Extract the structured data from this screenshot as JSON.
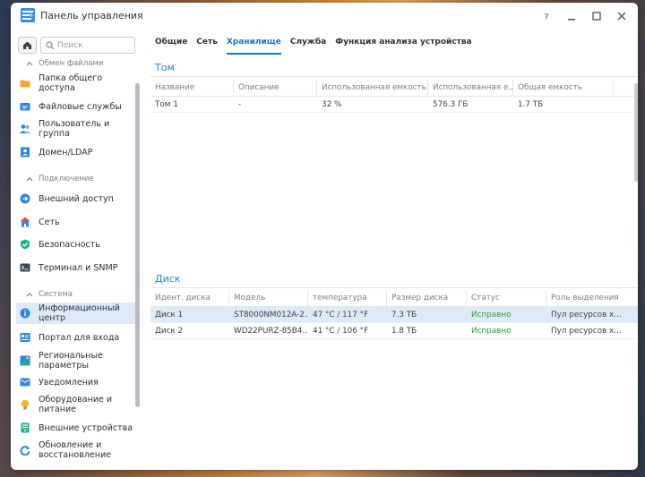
{
  "window": {
    "title": "Панель управления"
  },
  "sidebar": {
    "search_placeholder": "Поиск",
    "sections": [
      {
        "label": "Обмен файлами",
        "items": [
          {
            "label": "Папка общего доступа",
            "icon": "folder-icon"
          },
          {
            "label": "Файловые службы",
            "icon": "file-services-icon"
          },
          {
            "label": "Пользователь и группа",
            "icon": "users-icon"
          },
          {
            "label": "Домен/LDAP",
            "icon": "domain-icon"
          }
        ]
      },
      {
        "label": "Подключение",
        "items": [
          {
            "label": "Внешний доступ",
            "icon": "external-access-icon"
          },
          {
            "label": "Сеть",
            "icon": "network-icon"
          },
          {
            "label": "Безопасность",
            "icon": "shield-icon"
          },
          {
            "label": "Терминал и SNMP",
            "icon": "terminal-icon"
          }
        ]
      },
      {
        "label": "Система",
        "items": [
          {
            "label": "Информационный центр",
            "icon": "info-icon"
          },
          {
            "label": "Портал для входа",
            "icon": "portal-icon"
          },
          {
            "label": "Региональные параметры",
            "icon": "regional-icon"
          },
          {
            "label": "Уведомления",
            "icon": "notification-icon"
          },
          {
            "label": "Оборудование и питание",
            "icon": "bulb-icon"
          },
          {
            "label": "Внешние устройства",
            "icon": "external-devices-icon"
          },
          {
            "label": "Обновление и восстановление",
            "icon": "update-icon"
          }
        ]
      }
    ]
  },
  "tabs": [
    "Общие",
    "Сеть",
    "Хранилище",
    "Служба",
    "Функция анализа устройства"
  ],
  "active_tab": "Хранилище",
  "volume_section": {
    "title": "Том",
    "columns": [
      "Название",
      "Описание",
      "Использованная емкость ...",
      "Использованная е...",
      "Общая емкость"
    ],
    "rows": [
      [
        "Том 1",
        "-",
        "32 %",
        "576.3 ГБ",
        "1.7 ТБ"
      ]
    ]
  },
  "disk_section": {
    "title": "Диск",
    "columns": [
      "Идент. диска",
      "Модель",
      "температура",
      "Размер диска",
      "Статус",
      "Роль выделения"
    ],
    "rows": [
      [
        "Диск 1",
        "ST8000NM012A-2...",
        "47 °C / 117 °F",
        "7.3 ТБ",
        "Исправно",
        "Пул ресурсов х..."
      ],
      [
        "Диск 2",
        "WD22PURZ-85B4...",
        "41 °C / 106 °F",
        "1.8 ТБ",
        "Исправно",
        "Пул ресурсов х..."
      ]
    ]
  },
  "colors": {
    "accent": "#1a73c9",
    "ok": "#2a9a3a",
    "selected_row": "#dfeaf8"
  }
}
